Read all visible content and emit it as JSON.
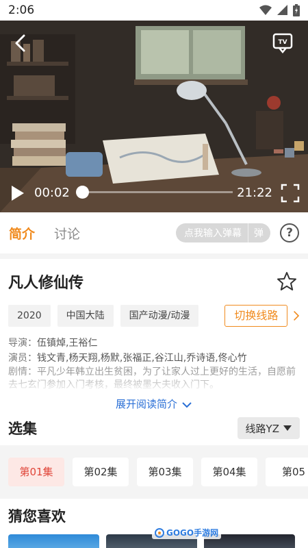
{
  "status_bar": {
    "time": "2:06"
  },
  "player": {
    "current_time": "00:02",
    "total_time": "21:22",
    "progress": 0.002
  },
  "tabs": [
    {
      "label": "简介"
    },
    {
      "label": "讨论"
    }
  ],
  "danmu": {
    "placeholder": "点我输入弹幕",
    "button": "弹"
  },
  "help": {
    "icon": "help-icon",
    "glyph": "?"
  },
  "info": {
    "title": "凡人修仙传",
    "tags": [
      "2020",
      "中国大陆",
      "国产动漫/动漫"
    ],
    "switch_line": "切换线路",
    "director_label": "导演：",
    "director": "伍镇焯,王裕仁",
    "cast_label": "演员：",
    "cast": "钱文青,杨天翔,杨默,张福正,谷江山,乔诗语,佟心竹",
    "plot_label": "剧情：",
    "plot": "平凡少年韩立出生贫困，为了让家人过上更好的生活，自愿前去七玄门参加入门考核，最终被墨大夫收入门下。",
    "expand": "展开阅读简介"
  },
  "episodes": {
    "title": "选集",
    "line": "线路YZ",
    "items": [
      "第01集",
      "第02集",
      "第03集",
      "第04集",
      "第05"
    ]
  },
  "recommend": {
    "title": "猜您喜欢"
  },
  "watermark": "GOGO手游网",
  "colors": {
    "accent": "#f08a1d",
    "episode_active": "#e0463a",
    "link": "#2a6fd6"
  }
}
